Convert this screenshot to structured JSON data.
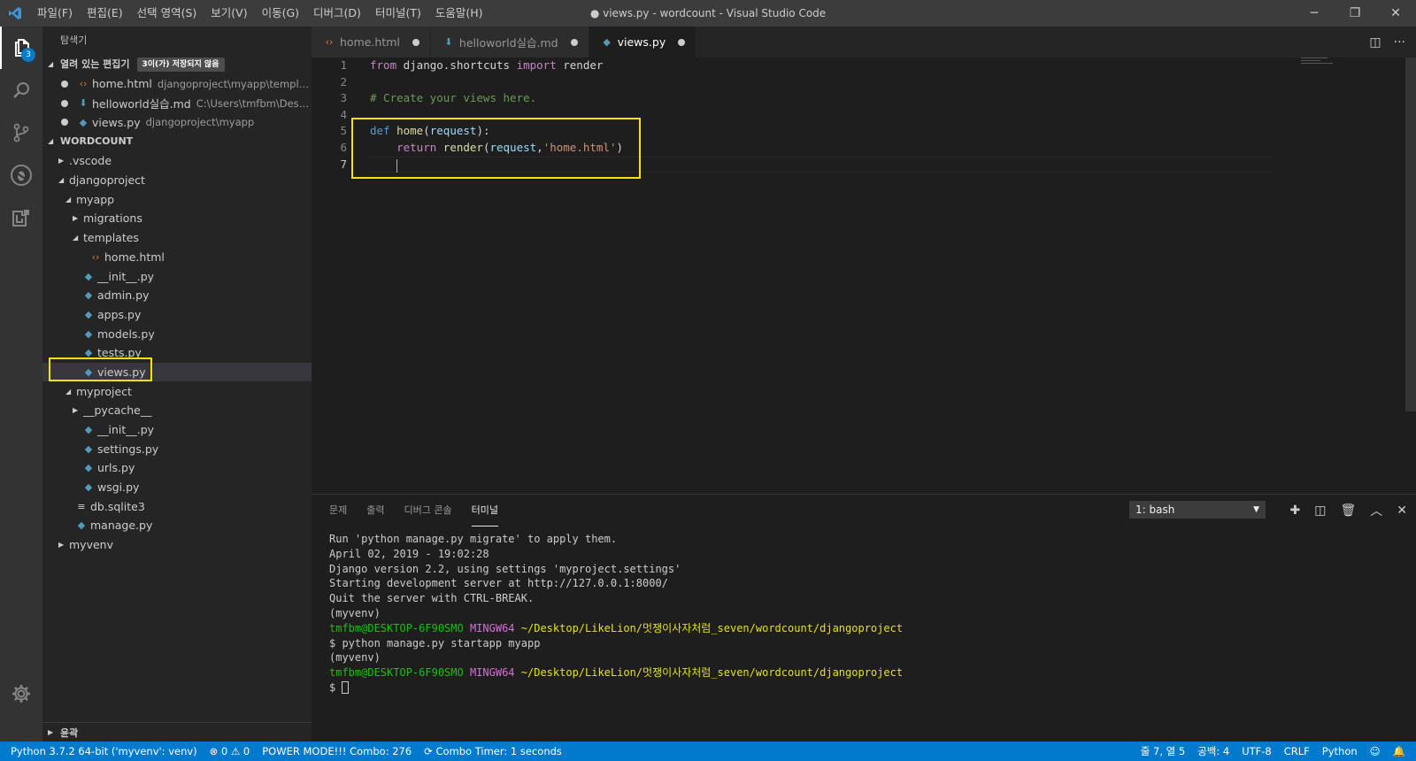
{
  "window": {
    "title": "● views.py - wordcount - Visual Studio Code",
    "logo": "vscode-logo",
    "menu": [
      "파일(F)",
      "편집(E)",
      "선택 영역(S)",
      "보기(V)",
      "이동(G)",
      "디버그(D)",
      "터미널(T)",
      "도움말(H)"
    ],
    "controls": {
      "minimize": "─",
      "restore": "❐",
      "close": "✕"
    }
  },
  "activity": {
    "explorer_badge": "3"
  },
  "sidebar": {
    "title": "탐색기",
    "open_editors": {
      "label": "열려 있는 편집기",
      "badge": "3이(가) 저장되지 않음",
      "items": [
        {
          "name": "home.html",
          "path": "djangoproject\\myapp\\templates",
          "icon": "html-icon"
        },
        {
          "name": "helloworld실습.md",
          "path": "C:\\Users\\tmfbm\\Desktop...",
          "icon": "markdown-icon"
        },
        {
          "name": "views.py",
          "path": "djangoproject\\myapp",
          "icon": "python-icon"
        }
      ]
    },
    "workspace": {
      "label": "WORDCOUNT",
      "tree": [
        {
          "name": ".vscode",
          "type": "folder-collapsed",
          "depth": 0
        },
        {
          "name": "djangoproject",
          "type": "folder-open",
          "depth": 0
        },
        {
          "name": "myapp",
          "type": "folder-open",
          "depth": 1
        },
        {
          "name": "migrations",
          "type": "folder-collapsed",
          "depth": 2
        },
        {
          "name": "templates",
          "type": "folder-open",
          "depth": 2
        },
        {
          "name": "home.html",
          "type": "html",
          "depth": 3
        },
        {
          "name": "__init__.py",
          "type": "py",
          "depth": 2
        },
        {
          "name": "admin.py",
          "type": "py",
          "depth": 2
        },
        {
          "name": "apps.py",
          "type": "py",
          "depth": 2
        },
        {
          "name": "models.py",
          "type": "py",
          "depth": 2
        },
        {
          "name": "tests.py",
          "type": "py",
          "depth": 2
        },
        {
          "name": "views.py",
          "type": "py",
          "depth": 2,
          "selected": true
        },
        {
          "name": "myproject",
          "type": "folder-open",
          "depth": 1
        },
        {
          "name": "__pycache__",
          "type": "folder-collapsed",
          "depth": 2
        },
        {
          "name": "__init__.py",
          "type": "py",
          "depth": 2
        },
        {
          "name": "settings.py",
          "type": "py",
          "depth": 2
        },
        {
          "name": "urls.py",
          "type": "py",
          "depth": 2
        },
        {
          "name": "wsgi.py",
          "type": "py",
          "depth": 2
        },
        {
          "name": "db.sqlite3",
          "type": "db",
          "depth": 1
        },
        {
          "name": "manage.py",
          "type": "py",
          "depth": 1
        },
        {
          "name": "myvenv",
          "type": "folder-collapsed",
          "depth": 0
        }
      ]
    },
    "outline_label": "윤곽"
  },
  "tabs": [
    {
      "name": "home.html",
      "icon": "html-icon",
      "active": false
    },
    {
      "name": "helloworld실습.md",
      "icon": "markdown-icon",
      "active": false
    },
    {
      "name": "views.py",
      "icon": "python-icon",
      "active": true
    }
  ],
  "editor": {
    "line_numbers": [
      "1",
      "2",
      "3",
      "4",
      "5",
      "6",
      "7"
    ],
    "lines": [
      [
        [
          "k-kw",
          "from"
        ],
        [
          "",
          " django.shortcuts "
        ],
        [
          "k-kw",
          "import"
        ],
        [
          "",
          " render"
        ]
      ],
      [],
      [
        [
          "k-com",
          "# Create your views here."
        ]
      ],
      [],
      [
        [
          "k-def",
          "def"
        ],
        [
          "",
          " "
        ],
        [
          "k-fn",
          "home"
        ],
        [
          "",
          "("
        ],
        [
          "k-param",
          "request"
        ],
        [
          "",
          "):"
        ]
      ],
      [
        [
          "",
          "    "
        ],
        [
          "k-kw",
          "return"
        ],
        [
          "",
          " "
        ],
        [
          "k-fn",
          "render"
        ],
        [
          "",
          "("
        ],
        [
          "k-param",
          "request"
        ],
        [
          "",
          ","
        ],
        [
          "k-str",
          "'home.html'"
        ],
        [
          "",
          ")"
        ]
      ],
      [
        [
          "",
          "    "
        ]
      ]
    ],
    "cursor_line": 7
  },
  "panel": {
    "tabs": [
      "문제",
      "출력",
      "디버그 콘솔",
      "터미널"
    ],
    "active_tab": "터미널",
    "terminal_select": "1: bash",
    "lines": [
      [
        [
          "",
          "Run 'python manage.py migrate' to apply them."
        ]
      ],
      [
        [
          "",
          "April 02, 2019 - 19:02:28"
        ]
      ],
      [
        [
          "",
          "Django version 2.2, using settings 'myproject.settings'"
        ]
      ],
      [
        [
          "",
          "Starting development server at http://127.0.0.1:8000/"
        ]
      ],
      [
        [
          "",
          "Quit the server with CTRL-BREAK."
        ]
      ],
      [
        [
          "",
          "(myvenv)"
        ]
      ],
      [
        [
          "t-green",
          "tmfbm@DESKTOP-6F90SMO"
        ],
        [
          "",
          " "
        ],
        [
          "t-mag",
          "MINGW64"
        ],
        [
          "",
          " "
        ],
        [
          "t-yel",
          "~/Desktop/LikeLion/멋쟁이사자처럼_seven/wordcount/djangoproject"
        ]
      ],
      [
        [
          "",
          "$ python manage.py startapp myapp"
        ]
      ],
      [
        [
          "",
          "(myvenv)"
        ]
      ],
      [
        [
          "t-green",
          "tmfbm@DESKTOP-6F90SMO"
        ],
        [
          "",
          " "
        ],
        [
          "t-mag",
          "MINGW64"
        ],
        [
          "",
          " "
        ],
        [
          "t-yel",
          "~/Desktop/LikeLion/멋쟁이사자처럼_seven/wordcount/djangoproject"
        ]
      ],
      [
        [
          "",
          "$ "
        ]
      ]
    ]
  },
  "statusbar": {
    "python": "Python 3.7.2 64-bit ('myvenv': venv)",
    "errors": "⊗ 0",
    "warnings": "⚠ 0",
    "power_mode": "POWER MODE!!! Combo: 276",
    "combo_timer": "⟳ Combo Timer: 1 seconds",
    "position": "줄 7, 열 5",
    "spaces": "공백: 4",
    "encoding": "UTF-8",
    "eol": "CRLF",
    "language": "Python",
    "feedback_icon": "☺",
    "bell_icon": "🔔"
  },
  "colors": {
    "statusbar": "#007acc",
    "highlight": "#f2e40b",
    "activitybar": "#333333",
    "sidebar": "#252526",
    "editor": "#1e1e1e"
  }
}
